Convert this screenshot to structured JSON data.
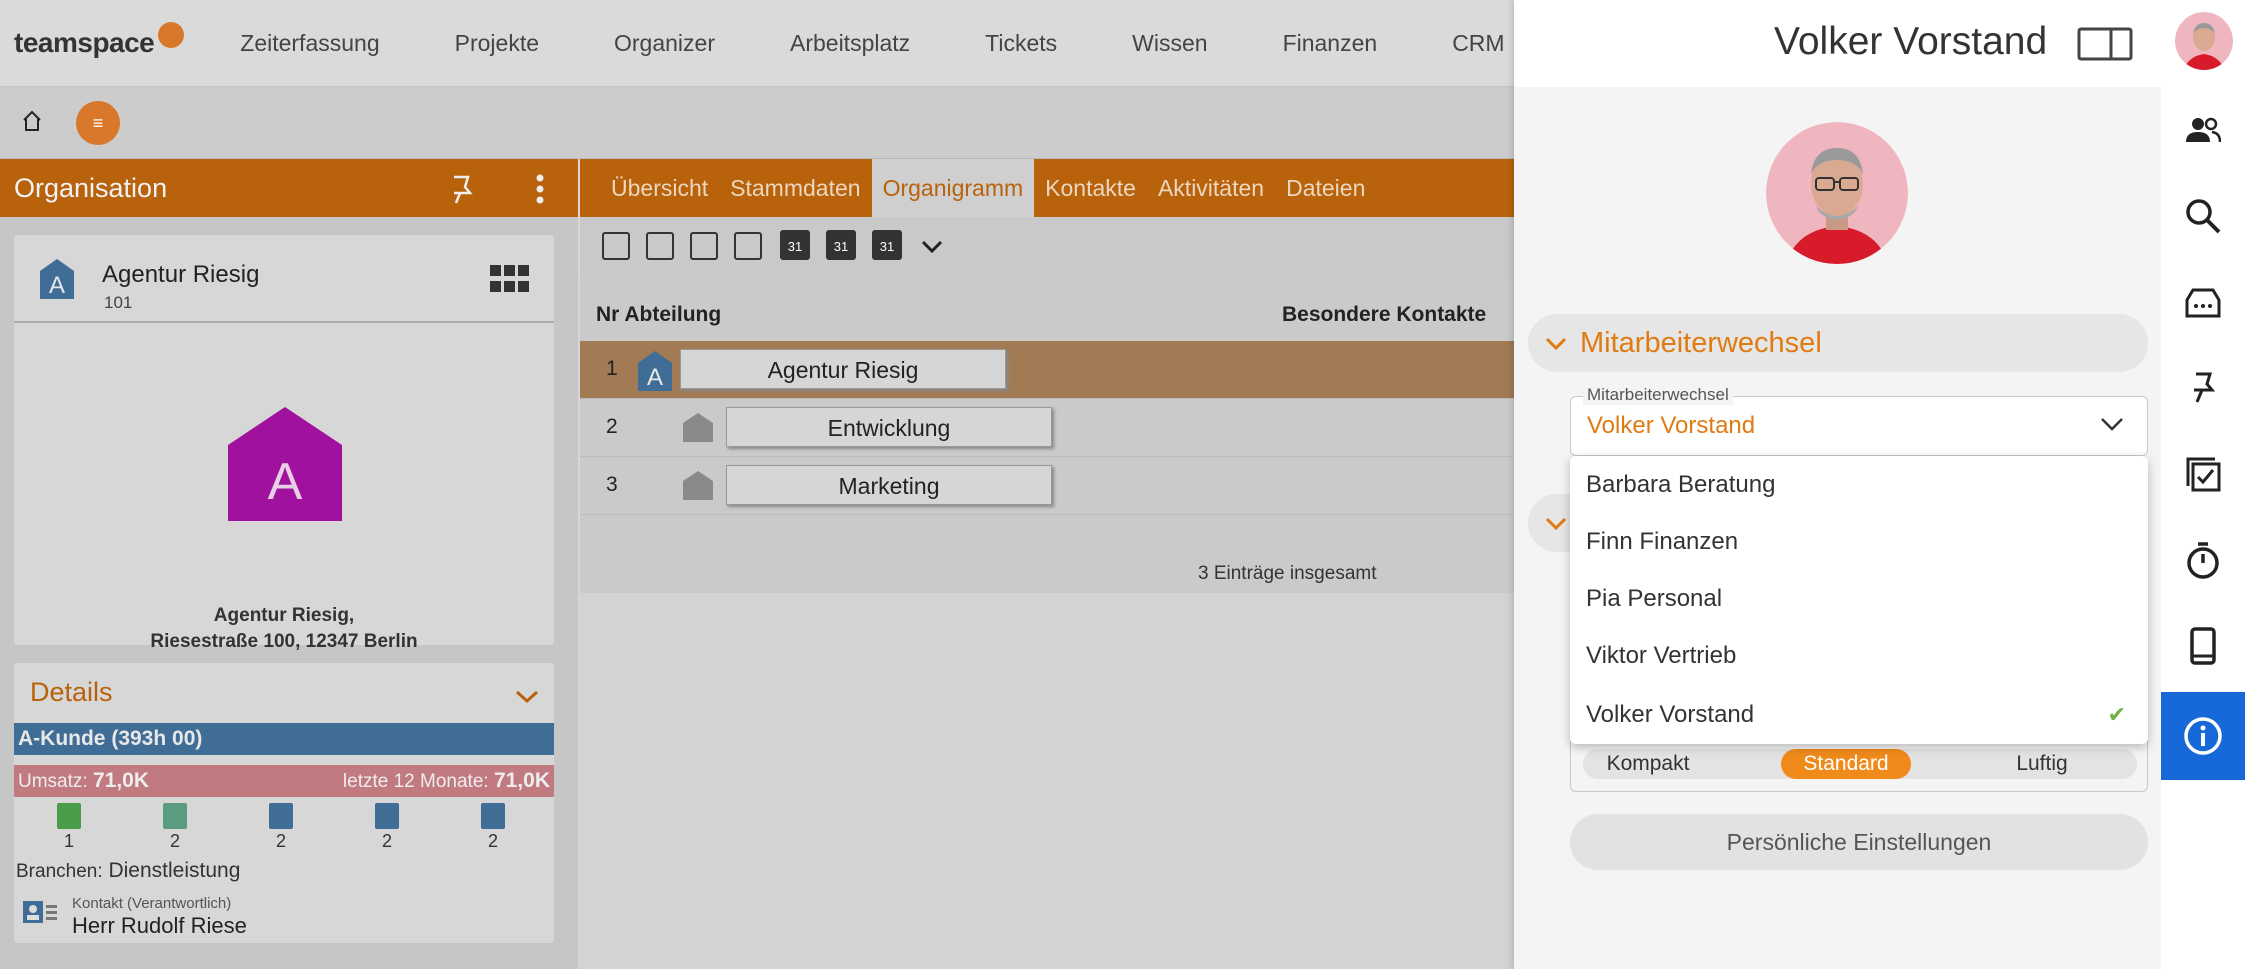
{
  "app": {
    "logo": "teamspace",
    "nav": [
      "Zeiterfassung",
      "Projekte",
      "Organizer",
      "Arbeitsplatz",
      "Tickets",
      "Wissen",
      "Finanzen",
      "CRM"
    ],
    "menu_glyph": "≡"
  },
  "left": {
    "header": "Organisation",
    "org_name": "Agentur Riesig",
    "org_nr": "101",
    "org_letter": "A",
    "address_line1": "Agentur Riesig,",
    "address_line2": "Riesestraße 100, 12347 Berlin",
    "details_title": "Details",
    "kunde": "A-Kunde (393h 00)",
    "umsatz_label": "Umsatz:",
    "umsatz_value": "71,0K",
    "letzte_label": "letzte 12 Monate:",
    "letzte_value": "71,0K",
    "icon_counts": [
      "1",
      "2",
      "2",
      "2",
      "2"
    ],
    "branchen_label": "Branchen:",
    "branchen_value": "Dienstleistung",
    "kontakt_label": "Kontakt (Verantwortlich)",
    "kontakt_name": "Herr Rudolf Riese"
  },
  "main": {
    "tabs": [
      "Übersicht",
      "Stammdaten",
      "Organigramm",
      "Kontakte",
      "Aktivitäten",
      "Dateien"
    ],
    "active_tab": "Organigramm",
    "cal_label": "31",
    "col_nr_abteilung": "Nr Abteilung",
    "col_besondere": "Besondere Kontakte",
    "rows": [
      {
        "nr": "1",
        "name": "Agentur Riesig"
      },
      {
        "nr": "2",
        "name": "Entwicklung"
      },
      {
        "nr": "3",
        "name": "Marketing"
      }
    ],
    "total": "3 Einträge insgesamt"
  },
  "panel": {
    "user_name": "Volker Vorstand",
    "section_title": "Mitarbeiterwechsel",
    "select_label": "Mitarbeiterwechsel",
    "select_value": "Volker Vorstand",
    "options": [
      "Barbara Beratung",
      "Finn Finanzen",
      "Pia Personal",
      "Viktor Vertrieb",
      "Volker Vorstand"
    ],
    "selected_option": "Volker Vorstand",
    "density": [
      "Kompakt",
      "Standard",
      "Luftig"
    ],
    "density_active": "Standard",
    "settings_button": "Persönliche Einstellungen",
    "check_glyph": "✔"
  },
  "colors": {
    "accent_orange": "#e07b12",
    "header_orange": "#b8620c",
    "rail_active": "#1769d9",
    "kunde_blue": "#3f6d96",
    "org_purple": "#a0119e"
  }
}
